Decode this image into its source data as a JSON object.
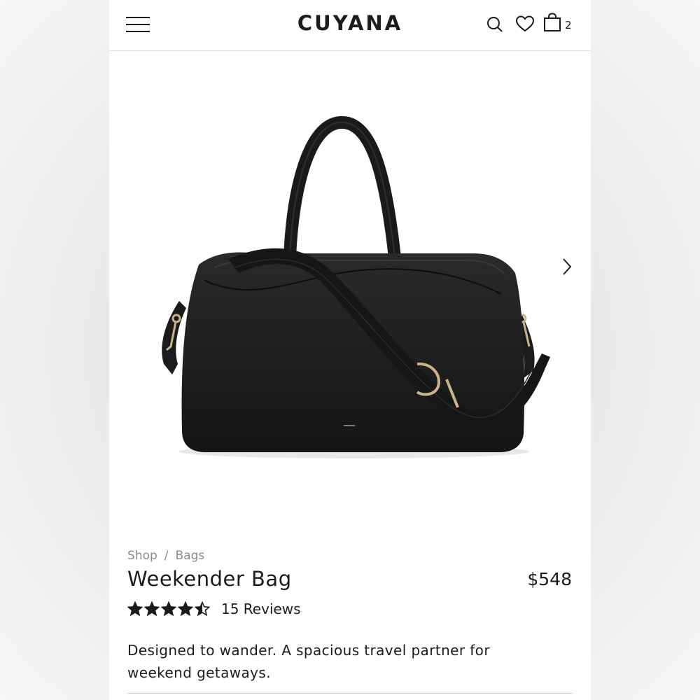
{
  "header": {
    "logo": "CUYANA",
    "cart_count": "2",
    "icons": [
      "menu-icon",
      "search-icon",
      "heart-icon",
      "shopping-bag-icon"
    ]
  },
  "gallery": {
    "image": "Black leather weekender bag with shoulder strap",
    "next_icon": "chevron-right-icon"
  },
  "breadcrumb": {
    "items": [
      "Shop",
      "Bags"
    ],
    "separator": "/"
  },
  "product": {
    "title": "Weekender Bag",
    "price": "$548",
    "rating": 4.5,
    "rating_max": 5,
    "reviews_label": "15 Reviews",
    "description": "Designed to wander. A spacious travel partner for weekend getaways."
  },
  "colors": {
    "text": "#1c1c1c",
    "muted": "#8c8c8c",
    "leather": "#1e1e1e",
    "hardware": "#c9b48a"
  }
}
